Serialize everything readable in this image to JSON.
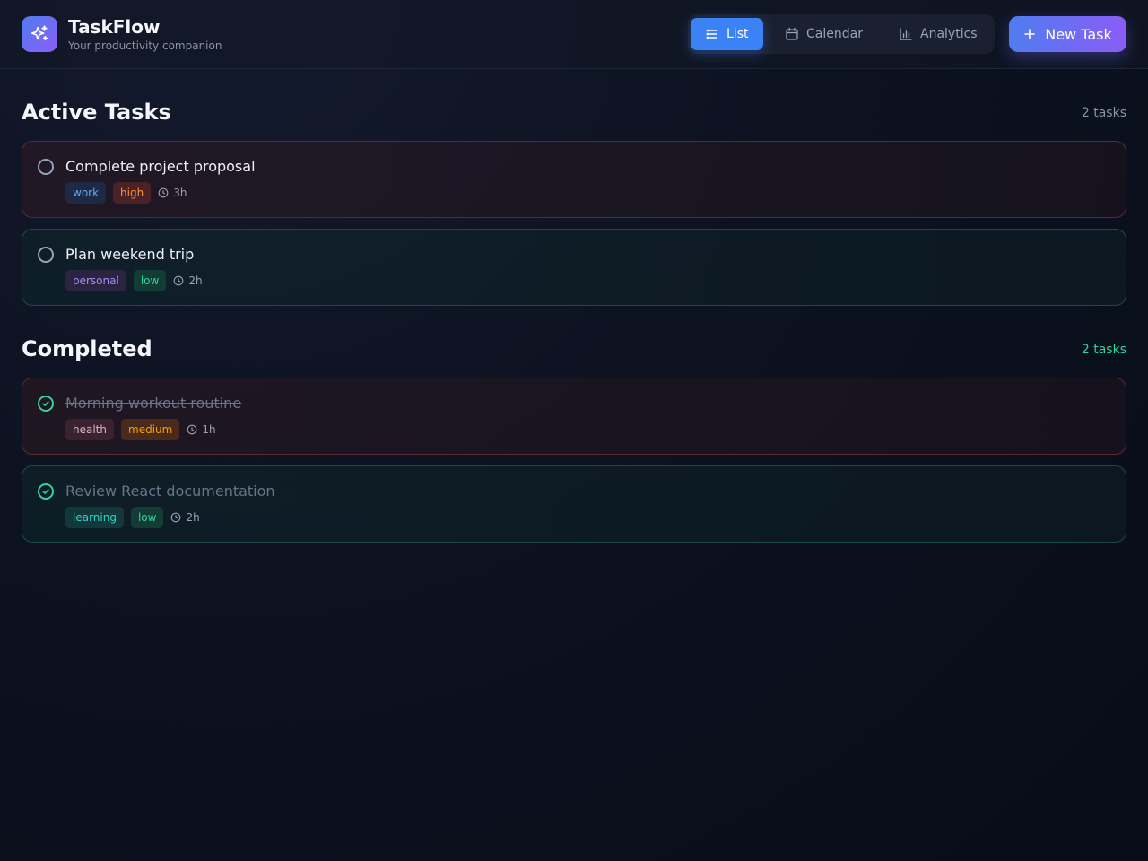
{
  "app": {
    "title": "TaskFlow",
    "subtitle": "Your productivity companion"
  },
  "nav": {
    "views": [
      {
        "label": "List",
        "icon": "list-icon",
        "active": true
      },
      {
        "label": "Calendar",
        "icon": "calendar-icon",
        "active": false
      },
      {
        "label": "Analytics",
        "icon": "bar-chart-icon",
        "active": false
      }
    ],
    "new_task_label": "New Task"
  },
  "sections": {
    "active": {
      "title": "Active Tasks",
      "count": "2 tasks",
      "tasks": [
        {
          "title": "Complete project proposal",
          "category": "work",
          "priority": "high",
          "duration": "3h"
        },
        {
          "title": "Plan weekend trip",
          "category": "personal",
          "priority": "low",
          "duration": "2h"
        }
      ]
    },
    "completed": {
      "title": "Completed",
      "count": "2 tasks",
      "tasks": [
        {
          "title": "Morning workout routine",
          "category": "health",
          "priority": "medium",
          "duration": "1h"
        },
        {
          "title": "Review React documentation",
          "category": "learning",
          "priority": "low",
          "duration": "2h"
        }
      ]
    }
  },
  "colors": {
    "accent": "#3b82f6",
    "gradient_start": "#4f7df0",
    "gradient_end": "#8b5cf6",
    "completed": "#34d399",
    "tag_work": "#60a5fa",
    "tag_high": "#fb923c",
    "tag_personal": "#a78bfa",
    "tag_low": "#34d399",
    "tag_health": "#f9a8b4",
    "tag_medium": "#f59e0b",
    "tag_learning": "#2dd4bf"
  }
}
